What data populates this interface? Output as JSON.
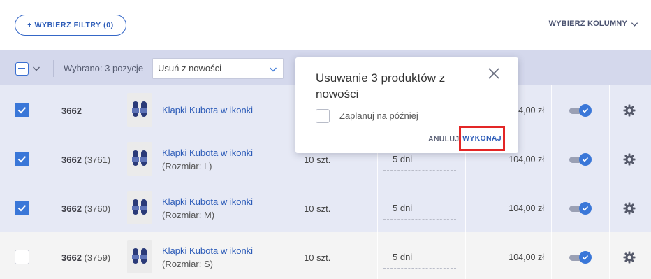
{
  "toolbar": {
    "filters_label": "+ WYBIERZ FILTRY (0)",
    "columns_label": "WYBIERZ KOLUMNY"
  },
  "bulk": {
    "selected_text": "Wybrano: 3 pozycje",
    "action_value": "Usuń z nowości"
  },
  "rows": [
    {
      "checked": true,
      "id": "3662",
      "variant_id": "",
      "name": "Klapki Kubota w ikonki",
      "size": "",
      "qty": "",
      "days": "",
      "price": "104,00 zł"
    },
    {
      "checked": true,
      "id": "3662",
      "variant_id": "(3761)",
      "name": "Klapki Kubota w ikonki",
      "size": "(Rozmiar: L)",
      "qty": "10 szt.",
      "days": "5 dni",
      "price": "104,00 zł"
    },
    {
      "checked": true,
      "id": "3662",
      "variant_id": "(3760)",
      "name": "Klapki Kubota w ikonki",
      "size": "(Rozmiar: M)",
      "qty": "10 szt.",
      "days": "5 dni",
      "price": "104,00 zł"
    },
    {
      "checked": false,
      "id": "3662",
      "variant_id": "(3759)",
      "name": "Klapki Kubota w ikonki",
      "size": "(Rozmiar: S)",
      "qty": "10 szt.",
      "days": "5 dni",
      "price": "104,00 zł"
    }
  ],
  "modal": {
    "title": "Usuwanie 3 produktów z nowości",
    "schedule_label": "Zaplanuj na później",
    "cancel_label": "ANULUJ",
    "execute_label": "WYKONAJ"
  },
  "colors": {
    "accent": "#3a77d8",
    "link": "#2d5cb8",
    "highlight_border": "#e32626",
    "selected_row_bg": "#e6e9f5",
    "bulk_bar_bg": "#d4d8ec"
  },
  "icons": {
    "columns_dropdown": "chevron-down-icon",
    "select_caret": "chevron-down-icon",
    "modal_close": "close-icon",
    "row_settings": "gear-icon",
    "row_active": "toggle-on-check-icon",
    "product_image": "slippers-icon"
  }
}
